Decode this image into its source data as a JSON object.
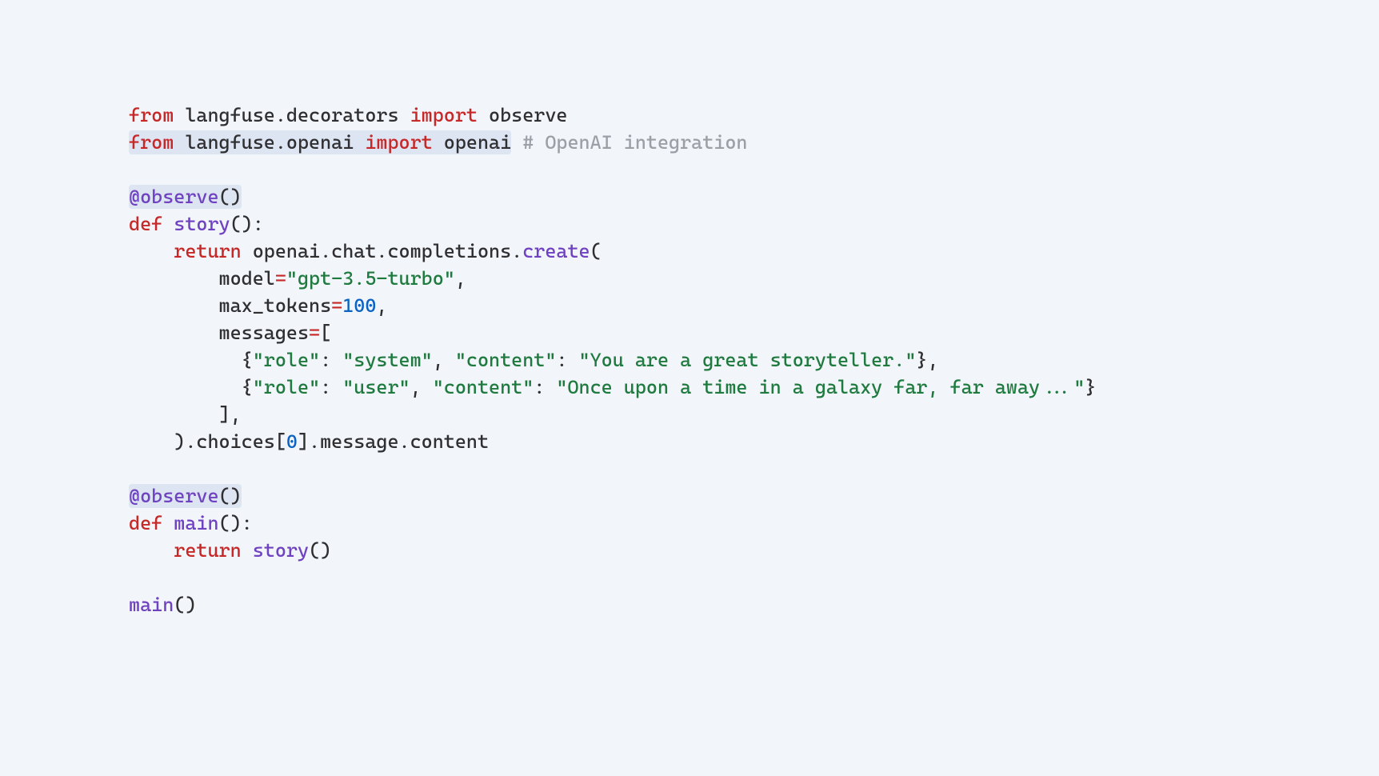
{
  "tokens": {
    "kw_from": "from",
    "kw_import": "import",
    "kw_def": "def",
    "kw_return": "return",
    "mod1": "langfuse.decorators",
    "imp1": "observe",
    "mod2": "langfuse.openai",
    "imp2": "openai",
    "comment2": "# OpenAI integration",
    "decorator_at": "@",
    "decorator_name": "observe",
    "decorator_parens": "()",
    "fn_story": "story",
    "fn_main": "main",
    "parens_empty": "()",
    "colon": ":",
    "chain_pre": "openai.chat.completions.",
    "chain_create": "create",
    "lparen": "(",
    "rparen": ")",
    "arg_model": "model",
    "eq": "=",
    "str_model": "\"gpt-3.5-turbo\"",
    "comma": ",",
    "arg_max": "max_tokens",
    "num_100": "100",
    "arg_messages": "messages",
    "lbracket": "[",
    "rbracket": "]",
    "msg1_open": "{",
    "msg1_role_k": "\"role\"",
    "msg1_colon": ": ",
    "msg1_role_v": "\"system\"",
    "msg1_sep": ", ",
    "msg1_content_k": "\"content\"",
    "msg1_content_v": "\"You are a great storyteller.\"",
    "msg1_close": "}",
    "msg2_open": "{",
    "msg2_role_v": "\"user\"",
    "msg2_content_v": "\"Once upon a time in a galaxy far, far away...\"",
    "msg2_close": "}",
    "tail_choices": ".choices[",
    "tail_zero": "0",
    "tail_rest": "].message.content",
    "call_story": "story",
    "call_main": "main"
  }
}
